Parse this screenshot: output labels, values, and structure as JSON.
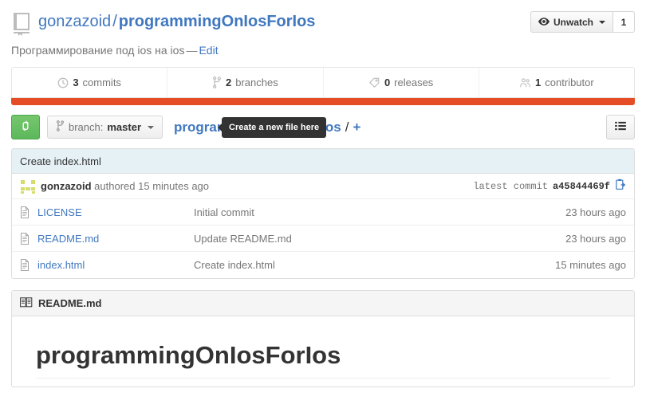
{
  "header": {
    "repo_icon": "repo-book-icon",
    "owner": "gonzazoid",
    "separator": "/",
    "repo_name": "programmingOnIosForIos",
    "watch_label": "Unwatch",
    "watch_icon": "eye-icon",
    "watch_count": "1"
  },
  "description": {
    "text": "Программирование под ios на ios",
    "dash": "—",
    "edit_label": "Edit"
  },
  "stats": [
    {
      "icon": "history-icon",
      "count": "3",
      "label": "commits"
    },
    {
      "icon": "git-branch-icon",
      "count": "2",
      "label": "branches"
    },
    {
      "icon": "tag-icon",
      "count": "0",
      "label": "releases"
    },
    {
      "icon": "people-icon",
      "count": "1",
      "label": "contributor"
    }
  ],
  "language_bar_color": "#e44d26",
  "toolbar": {
    "compare_icon": "compare-pull-request-icon",
    "branch_icon": "git-branch-icon",
    "branch_prefix": "branch:",
    "branch_name": "master",
    "breadcrumb_repo": "programmingOnIosForIos",
    "breadcrumb_separator": "/",
    "add_file_label": "+",
    "tooltip_text": "Create a new file here",
    "find_file_icon": "list-icon"
  },
  "latest_commit": {
    "message": "Create index.html",
    "avatar": "identicon",
    "author": "gonzazoid",
    "action": "authored",
    "time": "15 minutes ago",
    "sha_label": "latest commit",
    "sha": "a45844469f",
    "copy_icon": "clipboard-copy-icon"
  },
  "files": [
    {
      "icon": "file-text-icon",
      "name": "LICENSE",
      "message": "Initial commit",
      "age": "23 hours ago"
    },
    {
      "icon": "file-text-icon",
      "name": "README.md",
      "message": "Update README.md",
      "age": "23 hours ago"
    },
    {
      "icon": "file-text-icon",
      "name": "index.html",
      "message": "Create index.html",
      "age": "15 minutes ago"
    }
  ],
  "readme": {
    "icon": "book-icon",
    "title": "README.md",
    "heading": "programmingOnIosForIos"
  },
  "colors": {
    "link": "#4078c0",
    "muted": "#767676",
    "orange": "#e44d26",
    "green": "#5cb85c",
    "commit_bg": "#e6f1f6"
  }
}
